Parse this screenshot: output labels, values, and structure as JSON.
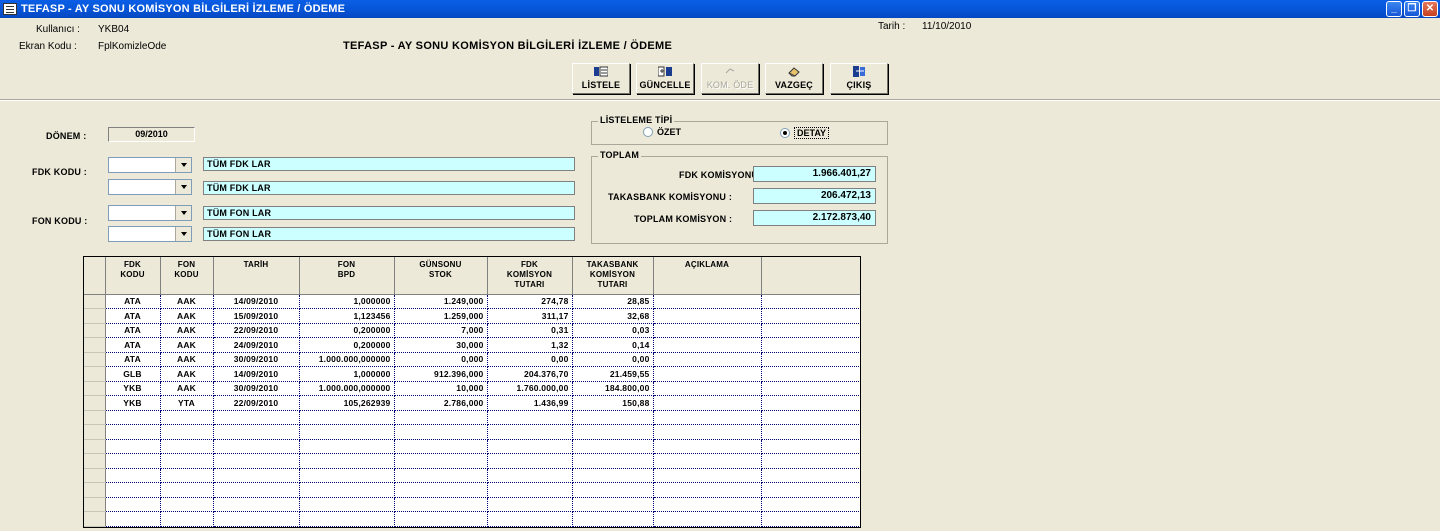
{
  "window": {
    "title": "TEFASP - AY SONU KOMİSYON BİLGİLERİ İZLEME / ÖDEME"
  },
  "header": {
    "user_label": "Kullanıcı :",
    "user_value": "YKB04",
    "screen_code_label": "Ekran Kodu :",
    "screen_code_value": "FplKomizleOde",
    "date_label": "Tarih :",
    "date_value": "11/10/2010",
    "screen_title": "TEFASP - AY SONU KOMİSYON BİLGİLERİ İZLEME / ÖDEME"
  },
  "toolbar": {
    "listele": "LİSTELE",
    "guncelle": "GÜNCELLE",
    "kom_ode": "KOM. ÖDE",
    "vazgec": "VAZGEÇ",
    "cikis": "ÇIKIŞ"
  },
  "form": {
    "donem_label": "DÖNEM :",
    "donem_value": "09/2010",
    "fdk_kodu_label": "FDK KODU :",
    "fon_kodu_label": "FON KODU :",
    "fdk1_desc": "TÜM FDK LAR",
    "fdk2_desc": "TÜM FDK LAR",
    "fon1_desc": "TÜM FON LAR",
    "fon2_desc": "TÜM FON LAR"
  },
  "listeleme": {
    "title": "LİSTELEME TİPİ",
    "ozet": "ÖZET",
    "detay": "DETAY",
    "selected": "DETAY"
  },
  "toplam": {
    "title": "TOPLAM",
    "fdk_label": "FDK KOMİSYONU :",
    "fdk_value": "1.966.401,27",
    "takasbank_label": "TAKASBANK KOMİSYONU :",
    "takasbank_value": "206.472,13",
    "toplam_label": "TOPLAM KOMİSYON :",
    "toplam_value": "2.172.873,40"
  },
  "grid": {
    "columns": [
      [
        "FDK",
        "KODU"
      ],
      [
        "FON",
        "KODU"
      ],
      [
        "TARİH"
      ],
      [
        "FON",
        "BPD"
      ],
      [
        "GÜNSONU",
        "STOK"
      ],
      [
        "FDK",
        "KOMİSYON",
        "TUTARI"
      ],
      [
        "TAKASBANK",
        "KOMİSYON",
        "TUTARI"
      ],
      [
        "AÇIKLAMA"
      ]
    ],
    "rows": [
      [
        "ATA",
        "AAK",
        "14/09/2010",
        "1,000000",
        "1.249,000",
        "274,78",
        "28,85",
        ""
      ],
      [
        "ATA",
        "AAK",
        "15/09/2010",
        "1,123456",
        "1.259,000",
        "311,17",
        "32,68",
        ""
      ],
      [
        "ATA",
        "AAK",
        "22/09/2010",
        "0,200000",
        "7,000",
        "0,31",
        "0,03",
        ""
      ],
      [
        "ATA",
        "AAK",
        "24/09/2010",
        "0,200000",
        "30,000",
        "1,32",
        "0,14",
        ""
      ],
      [
        "ATA",
        "AAK",
        "30/09/2010",
        "1.000.000,000000",
        "0,000",
        "0,00",
        "0,00",
        ""
      ],
      [
        "GLB",
        "AAK",
        "14/09/2010",
        "1,000000",
        "912.396,000",
        "204.376,70",
        "21.459,55",
        ""
      ],
      [
        "YKB",
        "AAK",
        "30/09/2010",
        "1.000.000,000000",
        "10,000",
        "1.760.000,00",
        "184.800,00",
        ""
      ],
      [
        "YKB",
        "YTA",
        "22/09/2010",
        "105,262939",
        "2.786,000",
        "1.436,99",
        "150,88",
        ""
      ]
    ],
    "empty_rows": 8
  }
}
